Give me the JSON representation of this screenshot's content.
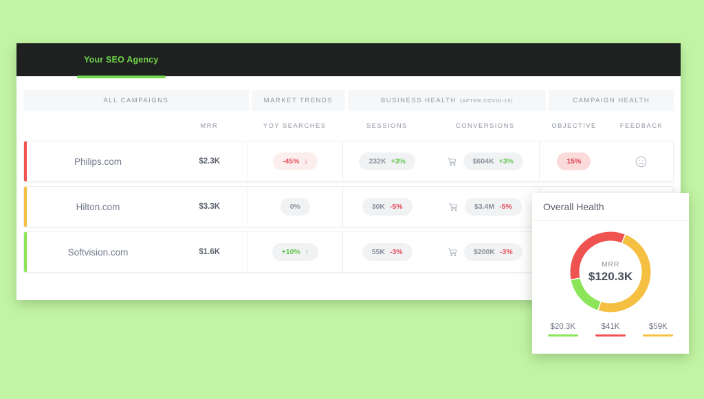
{
  "page": {
    "background_color": "#c2f5a3"
  },
  "topbar": {
    "brand_tab_label": "Your SEO Agency",
    "background_color": "#1f2120",
    "accent_color": "#74d94f"
  },
  "table": {
    "groups": [
      {
        "label": "ALL CAMPAIGNS",
        "sub": ""
      },
      {
        "label": "MARKET TRENDS",
        "sub": ""
      },
      {
        "label": "BUSINESS HEALTH",
        "sub": "(AFTER COVID-19)"
      },
      {
        "label": "CAMPAIGN HEALTH",
        "sub": ""
      }
    ],
    "columns": [
      {
        "key": "site",
        "label": ""
      },
      {
        "key": "mrr",
        "label": "MRR"
      },
      {
        "key": "yoy",
        "label": "YOY SEARCHES"
      },
      {
        "key": "sessions",
        "label": "SESSIONS"
      },
      {
        "key": "conversions",
        "label": "CONVERSIONS"
      },
      {
        "key": "objective",
        "label": "OBJECTIVE"
      },
      {
        "key": "feedback",
        "label": "FEEDBACK"
      }
    ],
    "rows": [
      {
        "accent_color": "#ef5350",
        "site": "Philips.com",
        "mrr": "$2.3K",
        "yoy_value": "-45%",
        "yoy_arrow": "↓",
        "yoy_state": "down",
        "sessions_value": "232K",
        "sessions_delta": "+3%",
        "sessions_state": "up",
        "conversions_value": "$604K",
        "conversions_delta": "+3%",
        "conversions_state": "up",
        "objective": "15%",
        "objective_state": "bad",
        "feedback_icon": "sad-face-icon"
      },
      {
        "accent_color": "#f5c042",
        "site": "Hilton.com",
        "mrr": "$3.3K",
        "yoy_value": "0%",
        "yoy_arrow": "",
        "yoy_state": "neutral",
        "sessions_value": "30K",
        "sessions_delta": "-5%",
        "sessions_state": "down",
        "conversions_value": "$3.4M",
        "conversions_delta": "-5%",
        "conversions_state": "down",
        "objective": "",
        "objective_state": "none",
        "feedback_icon": ""
      },
      {
        "accent_color": "#8ce558",
        "site": "Softvision.com",
        "mrr": "$1.6K",
        "yoy_value": "+10%",
        "yoy_arrow": "↑",
        "yoy_state": "up",
        "sessions_value": "55K",
        "sessions_delta": "-3%",
        "sessions_state": "down",
        "conversions_value": "$200K",
        "conversions_delta": "-3%",
        "conversions_state": "down",
        "objective": "",
        "objective_state": "none",
        "feedback_icon": ""
      }
    ]
  },
  "health_panel": {
    "title": "Overall Health",
    "center_label": "MRR",
    "center_value": "$120.3K",
    "legend": [
      {
        "value": "$20.3K",
        "color": "#8ce558"
      },
      {
        "value": "$41K",
        "color": "#ef5350"
      },
      {
        "value": "$59K",
        "color": "#f5c042"
      }
    ]
  },
  "chart_data": {
    "type": "pie",
    "title": "Overall Health",
    "subtitle": "MRR",
    "center_value": "$120.3K",
    "total": 120.3,
    "unit": "K USD",
    "categories": [
      "Green",
      "Red",
      "Yellow"
    ],
    "values": [
      20.3,
      41,
      59
    ],
    "labels": [
      "$20.3K",
      "$41K",
      "$59K"
    ],
    "colors": [
      "#8ce558",
      "#ef5350",
      "#f5c042"
    ],
    "donut": true,
    "inner_radius_ratio": 0.78,
    "legend_position": "bottom",
    "grid": false
  }
}
